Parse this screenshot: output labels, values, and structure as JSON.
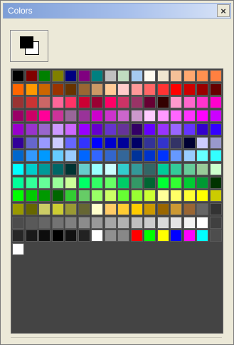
{
  "window": {
    "title": "Colors"
  },
  "swatches": {
    "foreground": "#000000",
    "background": "#ffffff"
  },
  "palette": {
    "columns": 16,
    "rows": [
      [
        "#000000",
        "#800000",
        "#008000",
        "#808000",
        "#000080",
        "#800080",
        "#008080",
        "#c0c0c0",
        "#c0dcc0",
        "#a6caf0",
        "#fffbf0",
        "#f0e6d0",
        "#f4c098",
        "#ffa870",
        "#ff9050",
        "#ff8040"
      ],
      [
        "#ff6600",
        "#ff9900",
        "#cc6600",
        "#993300",
        "#663300",
        "#996633",
        "#cc9966",
        "#ffcc99",
        "#ffcccc",
        "#ff9999",
        "#ff6666",
        "#ff3333",
        "#ff0000",
        "#cc0000",
        "#990000",
        "#660000"
      ],
      [
        "#993333",
        "#cc3333",
        "#cc6666",
        "#ff6699",
        "#ff3366",
        "#cc0033",
        "#990033",
        "#ff0066",
        "#cc3366",
        "#993366",
        "#660033",
        "#330000",
        "#ff99cc",
        "#ff66cc",
        "#ff33cc",
        "#ff00cc"
      ],
      [
        "#990066",
        "#cc0066",
        "#ff0099",
        "#cc3399",
        "#996699",
        "#993399",
        "#cc00cc",
        "#cc33cc",
        "#cc66cc",
        "#cc99cc",
        "#ffccff",
        "#ff99ff",
        "#ff66ff",
        "#ff33ff",
        "#ff00ff",
        "#cc00ff"
      ],
      [
        "#9900cc",
        "#9933cc",
        "#9966cc",
        "#cc99ff",
        "#cc66ff",
        "#9900ff",
        "#6600cc",
        "#6633cc",
        "#663399",
        "#330066",
        "#6600ff",
        "#9933ff",
        "#9966ff",
        "#6633ff",
        "#3300cc",
        "#3300ff"
      ],
      [
        "#330099",
        "#6666cc",
        "#9999ff",
        "#ccccff",
        "#6666ff",
        "#3333ff",
        "#0000ff",
        "#0000cc",
        "#000099",
        "#000066",
        "#333399",
        "#3333cc",
        "#333366",
        "#000033",
        "#ccccff",
        "#9999cc"
      ],
      [
        "#0066cc",
        "#3399ff",
        "#0099ff",
        "#66ccff",
        "#99ccff",
        "#0066ff",
        "#3366ff",
        "#3366cc",
        "#336699",
        "#003399",
        "#0033cc",
        "#0033ff",
        "#6699ff",
        "#99ccff",
        "#66ffff",
        "#33ffff"
      ],
      [
        "#00ffff",
        "#00cccc",
        "#009999",
        "#006666",
        "#003333",
        "#66cccc",
        "#99ffff",
        "#ccffff",
        "#33cccc",
        "#339999",
        "#336666",
        "#00cc99",
        "#33cc99",
        "#66cc99",
        "#99cc99",
        "#ccffcc"
      ],
      [
        "#00ff99",
        "#33ff99",
        "#66ff99",
        "#99ff99",
        "#ccff99",
        "#00ff66",
        "#33ff66",
        "#66ff66",
        "#00cc66",
        "#339966",
        "#006633",
        "#00ff33",
        "#33ff33",
        "#00cc33",
        "#009933",
        "#003300"
      ],
      [
        "#00ff00",
        "#00cc00",
        "#009900",
        "#006600",
        "#33cc33",
        "#66cc66",
        "#99ff66",
        "#ccff66",
        "#66ff33",
        "#99ff33",
        "#ccff33",
        "#ffff99",
        "#ffff66",
        "#ffff33",
        "#ffff00",
        "#cccc00"
      ],
      [
        "#999900",
        "#666600",
        "#cccc66",
        "#cccc33",
        "#999933",
        "#666633",
        "#ffffcc",
        "#ffcc66",
        "#ffcc33",
        "#ffcc00",
        "#cc9900",
        "#996600",
        "#cc9933",
        "#996633",
        "#666666",
        "#333333"
      ],
      [
        "#4c4c4c",
        "#595959",
        "#666666",
        "#737373",
        "#808080",
        "#8c8c8c",
        "#999999",
        "#a6a6a6",
        "#b2b2b2",
        "#bfbfbf",
        "#cccccc",
        "#d9d9d9",
        "#e5e5e5",
        "#f2f2f2",
        "#ffffff",
        "#404040"
      ],
      [
        "#262626",
        "#1a1a1a",
        "#0d0d0d",
        "#000000",
        "#111111",
        "#222222",
        "#ffffff",
        "#909090",
        "#888888",
        "#ff0000",
        "#00ff00",
        "#ffff00",
        "#0000ff",
        "#ff00ff",
        "#00ffff",
        "#4d4d4d"
      ],
      [
        "#ffffff"
      ]
    ]
  }
}
